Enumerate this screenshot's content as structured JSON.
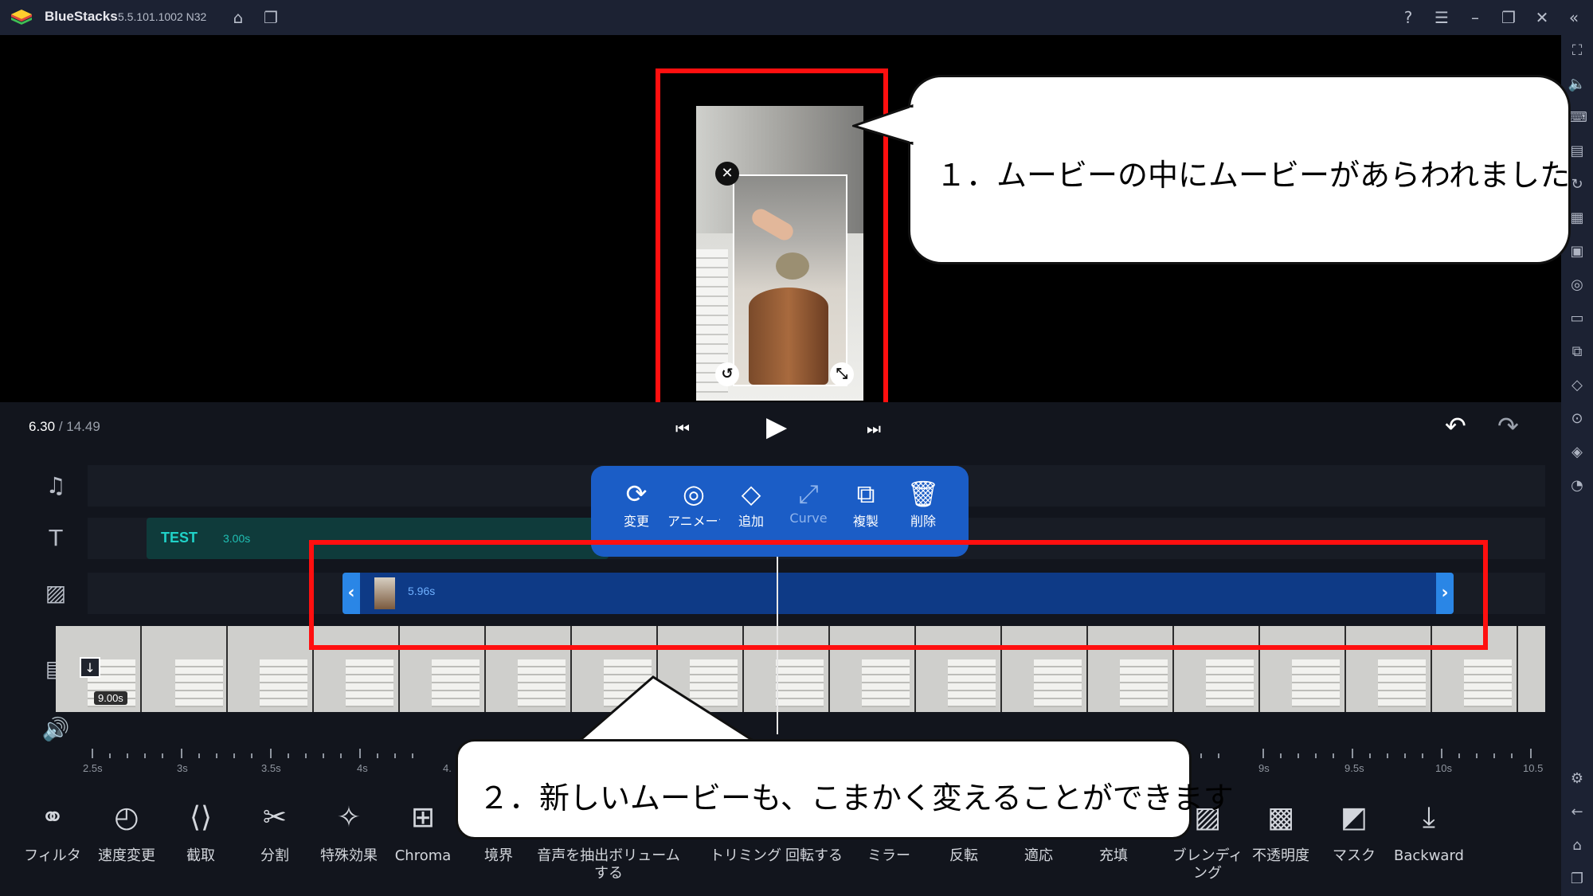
{
  "app": {
    "name": "BlueStacks",
    "version": "5.5.101.1002 N32"
  },
  "playback": {
    "current": "6.30",
    "total": "/ 14.49"
  },
  "tracks": {
    "text_clip": {
      "label": "TEST",
      "duration": "3.00s"
    },
    "pip_clip": {
      "duration": "5.96s"
    },
    "main_clip": {
      "duration": "9.00s"
    }
  },
  "float_menu": [
    {
      "icon": "replace-icon",
      "label": "変更"
    },
    {
      "icon": "animation-icon",
      "label": "アニメーション"
    },
    {
      "icon": "add-keyframe-icon",
      "label": "追加"
    },
    {
      "icon": "curve-icon",
      "label": "Curve"
    },
    {
      "icon": "duplicate-icon",
      "label": "複製"
    },
    {
      "icon": "trash-icon",
      "label": "削除"
    }
  ],
  "ruler": [
    "2.5s",
    "3s",
    "3.5s",
    "4s",
    "4.",
    "9s",
    "9.5s",
    "10s",
    "10.5"
  ],
  "toolbar": [
    {
      "icon": "filter-icon",
      "label": "フィルタ"
    },
    {
      "icon": "speedometer-icon",
      "label": "速度変更"
    },
    {
      "icon": "crop-icon",
      "label": "截取"
    },
    {
      "icon": "scissors-icon",
      "label": "分割"
    },
    {
      "icon": "sparkle-icon",
      "label": "特殊効果"
    },
    {
      "icon": "chroma-icon",
      "label": "Chroma"
    },
    {
      "icon": "border-icon",
      "label": "境界"
    },
    {
      "icon": "extract-audio-icon",
      "label": "音声を抽出ボリューム"
    },
    {
      "icon": "extract-audio-icon",
      "label": "する"
    },
    {
      "icon": "trim-icon",
      "label": "トリミング"
    },
    {
      "icon": "rotate-icon",
      "label": "回転する"
    },
    {
      "icon": "mirror-icon",
      "label": "ミラー"
    },
    {
      "icon": "flip-icon",
      "label": "反転"
    },
    {
      "icon": "fit-icon",
      "label": "適応"
    },
    {
      "icon": "fill-icon",
      "label": "充填"
    },
    {
      "icon": "blending-icon",
      "label": "ブレンディ"
    },
    {
      "icon": "blending-icon",
      "label": "ング"
    },
    {
      "icon": "opacity-icon",
      "label": "不透明度"
    },
    {
      "icon": "mask-icon",
      "label": "マスク"
    },
    {
      "icon": "backward-icon",
      "label": "Backward"
    }
  ],
  "callouts": {
    "top": "１．ムービーの中にムービーがあらわれました",
    "bottom": "２．新しいムービーも、こまかく変えることができます"
  }
}
